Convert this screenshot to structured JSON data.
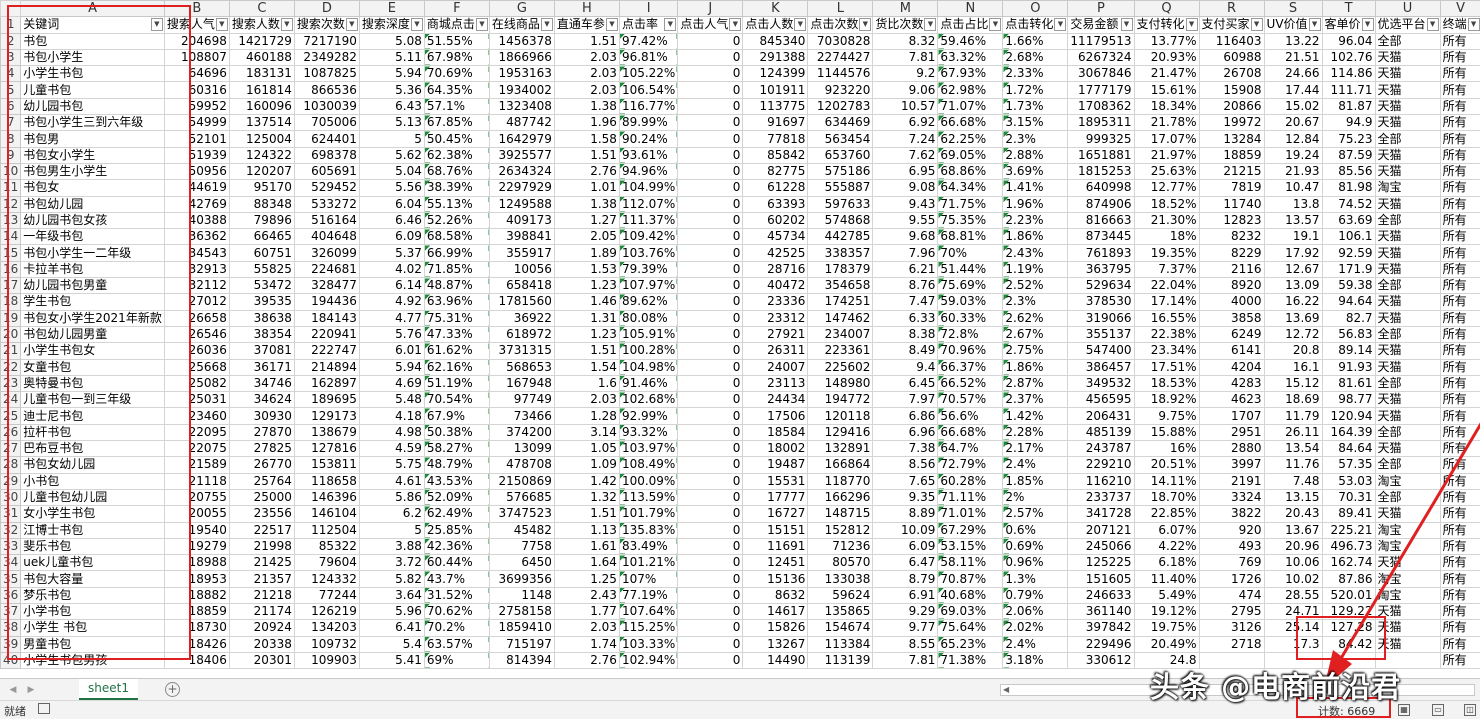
{
  "columns": [
    "A",
    "B",
    "C",
    "D",
    "E",
    "F",
    "G",
    "H",
    "I",
    "J",
    "K",
    "L",
    "M",
    "N",
    "O",
    "P",
    "Q",
    "R",
    "S",
    "T",
    "U",
    "V"
  ],
  "headers": [
    "关键词",
    "搜索人气",
    "搜索人数",
    "搜索次数",
    "搜索深度",
    "商城点击",
    "在线商品",
    "直通车参",
    "点击率",
    "点击人气",
    "点击人数",
    "点击次数",
    "货比次数",
    "点击占比",
    "点击转化",
    "交易金额",
    "支付转化",
    "支付买家",
    "UV价值",
    "客单价",
    "优选平台",
    "终端"
  ],
  "rows": [
    [
      "书包",
      "204698",
      "1421729",
      "7217190",
      "5.08",
      "51.55%",
      "1456378",
      "1.51",
      "97.42%",
      "0",
      "845340",
      "7030828",
      "8.32",
      "59.46%",
      "1.66%",
      "11179513",
      "13.77%",
      "116403",
      "13.22",
      "96.04",
      "全部",
      "所有"
    ],
    [
      "书包小学生",
      "108807",
      "460188",
      "2349282",
      "5.11",
      "67.98%",
      "1866966",
      "2.03",
      "96.81%",
      "0",
      "291388",
      "2274427",
      "7.81",
      "63.32%",
      "2.68%",
      "6267324",
      "20.93%",
      "60988",
      "21.51",
      "102.76",
      "天猫",
      "所有"
    ],
    [
      "小学生书包",
      "64696",
      "183131",
      "1087825",
      "5.94",
      "70.69%",
      "1953163",
      "2.03",
      "105.22%",
      "0",
      "124399",
      "1144576",
      "9.2",
      "67.93%",
      "2.33%",
      "3067846",
      "21.47%",
      "26708",
      "24.66",
      "114.86",
      "天猫",
      "所有"
    ],
    [
      "儿童书包",
      "60316",
      "161814",
      "866536",
      "5.36",
      "64.35%",
      "1934002",
      "2.03",
      "106.54%",
      "0",
      "101911",
      "923220",
      "9.06",
      "62.98%",
      "1.72%",
      "1777179",
      "15.61%",
      "15908",
      "17.44",
      "111.71",
      "天猫",
      "所有"
    ],
    [
      "幼儿园书包",
      "59952",
      "160096",
      "1030039",
      "6.43",
      "57.1%",
      "1323408",
      "1.38",
      "116.77%",
      "0",
      "113775",
      "1202783",
      "10.57",
      "71.07%",
      "1.73%",
      "1708362",
      "18.34%",
      "20866",
      "15.02",
      "81.87",
      "天猫",
      "所有"
    ],
    [
      "书包小学生三到六年级",
      "54999",
      "137514",
      "705006",
      "5.13",
      "67.85%",
      "487742",
      "1.96",
      "89.99%",
      "0",
      "91697",
      "634469",
      "6.92",
      "66.68%",
      "3.15%",
      "1895311",
      "21.78%",
      "19972",
      "20.67",
      "94.9",
      "天猫",
      "所有"
    ],
    [
      "书包男",
      "52101",
      "125004",
      "624401",
      "5",
      "50.45%",
      "1642979",
      "1.58",
      "90.24%",
      "0",
      "77818",
      "563454",
      "7.24",
      "62.25%",
      "2.3%",
      "999325",
      "17.07%",
      "13284",
      "12.84",
      "75.23",
      "全部",
      "所有"
    ],
    [
      "书包女小学生",
      "51939",
      "124322",
      "698378",
      "5.62",
      "62.38%",
      "3925577",
      "1.51",
      "93.61%",
      "0",
      "85842",
      "653760",
      "7.62",
      "69.05%",
      "2.88%",
      "1651881",
      "21.97%",
      "18859",
      "19.24",
      "87.59",
      "天猫",
      "所有"
    ],
    [
      "书包男生小学生",
      "50956",
      "120207",
      "605691",
      "5.04",
      "68.76%",
      "2634324",
      "2.76",
      "94.96%",
      "0",
      "82775",
      "575186",
      "6.95",
      "68.86%",
      "3.69%",
      "1815253",
      "25.63%",
      "21215",
      "21.93",
      "85.56",
      "天猫",
      "所有"
    ],
    [
      "书包女",
      "44619",
      "95170",
      "529452",
      "5.56",
      "38.39%",
      "2297929",
      "1.01",
      "104.99%",
      "0",
      "61228",
      "555887",
      "9.08",
      "64.34%",
      "1.41%",
      "640998",
      "12.77%",
      "7819",
      "10.47",
      "81.98",
      "淘宝",
      "所有"
    ],
    [
      "书包幼儿园",
      "42769",
      "88348",
      "533272",
      "6.04",
      "55.13%",
      "1249588",
      "1.38",
      "112.07%",
      "0",
      "63393",
      "597633",
      "9.43",
      "71.75%",
      "1.96%",
      "874906",
      "18.52%",
      "11740",
      "13.8",
      "74.52",
      "天猫",
      "所有"
    ],
    [
      "幼儿园书包女孩",
      "40388",
      "79896",
      "516164",
      "6.46",
      "52.26%",
      "409173",
      "1.27",
      "111.37%",
      "0",
      "60202",
      "574868",
      "9.55",
      "75.35%",
      "2.23%",
      "816663",
      "21.30%",
      "12823",
      "13.57",
      "63.69",
      "全部",
      "所有"
    ],
    [
      "一年级书包",
      "36362",
      "66465",
      "404648",
      "6.09",
      "68.58%",
      "398841",
      "2.05",
      "109.42%",
      "0",
      "45734",
      "442785",
      "9.68",
      "68.81%",
      "1.86%",
      "873445",
      "18%",
      "8232",
      "19.1",
      "106.1",
      "天猫",
      "所有"
    ],
    [
      "书包小学生一二年级",
      "34543",
      "60751",
      "326099",
      "5.37",
      "66.99%",
      "355917",
      "1.89",
      "103.76%",
      "0",
      "42525",
      "338357",
      "7.96",
      "70%",
      "2.43%",
      "761893",
      "19.35%",
      "8229",
      "17.92",
      "92.59",
      "天猫",
      "所有"
    ],
    [
      "卡拉羊书包",
      "32913",
      "55825",
      "224681",
      "4.02",
      "71.85%",
      "10056",
      "1.53",
      "79.39%",
      "0",
      "28716",
      "178379",
      "6.21",
      "51.44%",
      "1.19%",
      "363795",
      "7.37%",
      "2116",
      "12.67",
      "171.9",
      "天猫",
      "所有"
    ],
    [
      "幼儿园书包男童",
      "32112",
      "53472",
      "328477",
      "6.14",
      "48.87%",
      "658418",
      "1.23",
      "107.97%",
      "0",
      "40472",
      "354658",
      "8.76",
      "75.69%",
      "2.52%",
      "529634",
      "22.04%",
      "8920",
      "13.09",
      "59.38",
      "全部",
      "所有"
    ],
    [
      "学生书包",
      "27012",
      "39535",
      "194436",
      "4.92",
      "63.96%",
      "1781560",
      "1.46",
      "89.62%",
      "0",
      "23336",
      "174251",
      "7.47",
      "59.03%",
      "2.3%",
      "378530",
      "17.14%",
      "4000",
      "16.22",
      "94.64",
      "天猫",
      "所有"
    ],
    [
      "书包女小学生2021年新款",
      "26658",
      "38638",
      "184143",
      "4.77",
      "75.31%",
      "36922",
      "1.31",
      "80.08%",
      "0",
      "23312",
      "147462",
      "6.33",
      "60.33%",
      "2.62%",
      "319066",
      "16.55%",
      "3858",
      "13.69",
      "82.7",
      "天猫",
      "所有"
    ],
    [
      "书包幼儿园男童",
      "26546",
      "38354",
      "220941",
      "5.76",
      "47.33%",
      "618972",
      "1.23",
      "105.91%",
      "0",
      "27921",
      "234007",
      "8.38",
      "72.8%",
      "2.67%",
      "355137",
      "22.38%",
      "6249",
      "12.72",
      "56.83",
      "全部",
      "所有"
    ],
    [
      "小学生书包女",
      "26036",
      "37081",
      "222747",
      "6.01",
      "61.62%",
      "3731315",
      "1.51",
      "100.28%",
      "0",
      "26311",
      "223361",
      "8.49",
      "70.96%",
      "2.75%",
      "547400",
      "23.34%",
      "6141",
      "20.8",
      "89.14",
      "天猫",
      "所有"
    ],
    [
      "女童书包",
      "25668",
      "36171",
      "214894",
      "5.94",
      "62.16%",
      "568653",
      "1.54",
      "104.98%",
      "0",
      "24007",
      "225602",
      "9.4",
      "66.37%",
      "1.86%",
      "386457",
      "17.51%",
      "4204",
      "16.1",
      "91.93",
      "天猫",
      "所有"
    ],
    [
      "奥特曼书包",
      "25082",
      "34746",
      "162897",
      "4.69",
      "51.19%",
      "167948",
      "1.6",
      "91.46%",
      "0",
      "23113",
      "148980",
      "6.45",
      "66.52%",
      "2.87%",
      "349532",
      "18.53%",
      "4283",
      "15.12",
      "81.61",
      "全部",
      "所有"
    ],
    [
      "儿童书包一到三年级",
      "25031",
      "34624",
      "189695",
      "5.48",
      "70.54%",
      "97749",
      "2.03",
      "102.68%",
      "0",
      "24434",
      "194772",
      "7.97",
      "70.57%",
      "2.37%",
      "456595",
      "18.92%",
      "4623",
      "18.69",
      "98.77",
      "天猫",
      "所有"
    ],
    [
      "迪士尼书包",
      "23460",
      "30930",
      "129173",
      "4.18",
      "67.9%",
      "73466",
      "1.28",
      "92.99%",
      "0",
      "17506",
      "120118",
      "6.86",
      "56.6%",
      "1.42%",
      "206431",
      "9.75%",
      "1707",
      "11.79",
      "120.94",
      "天猫",
      "所有"
    ],
    [
      "拉杆书包",
      "22095",
      "27870",
      "138679",
      "4.98",
      "50.38%",
      "374200",
      "3.14",
      "93.32%",
      "0",
      "18584",
      "129416",
      "6.96",
      "66.68%",
      "2.28%",
      "485139",
      "15.88%",
      "2951",
      "26.11",
      "164.39",
      "全部",
      "所有"
    ],
    [
      "巴布豆书包",
      "22075",
      "27825",
      "127816",
      "4.59",
      "58.27%",
      "13099",
      "1.05",
      "103.97%",
      "0",
      "18002",
      "132891",
      "7.38",
      "64.7%",
      "2.17%",
      "243787",
      "16%",
      "2880",
      "13.54",
      "84.64",
      "天猫",
      "所有"
    ],
    [
      "书包女幼儿园",
      "21589",
      "26770",
      "153811",
      "5.75",
      "48.79%",
      "478708",
      "1.09",
      "108.49%",
      "0",
      "19487",
      "166864",
      "8.56",
      "72.79%",
      "2.4%",
      "229210",
      "20.51%",
      "3997",
      "11.76",
      "57.35",
      "全部",
      "所有"
    ],
    [
      "小书包",
      "21118",
      "25764",
      "118658",
      "4.61",
      "43.53%",
      "2150869",
      "1.42",
      "100.09%",
      "0",
      "15531",
      "118770",
      "7.65",
      "60.28%",
      "1.85%",
      "116210",
      "14.11%",
      "2191",
      "7.48",
      "53.03",
      "淘宝",
      "所有"
    ],
    [
      "儿童书包幼儿园",
      "20755",
      "25000",
      "146396",
      "5.86",
      "52.09%",
      "576685",
      "1.32",
      "113.59%",
      "0",
      "17777",
      "166296",
      "9.35",
      "71.11%",
      "2%",
      "233737",
      "18.70%",
      "3324",
      "13.15",
      "70.31",
      "全部",
      "所有"
    ],
    [
      "女小学生书包",
      "20055",
      "23556",
      "146104",
      "6.2",
      "62.49%",
      "3747523",
      "1.51",
      "101.79%",
      "0",
      "16727",
      "148715",
      "8.89",
      "71.01%",
      "2.57%",
      "341728",
      "22.85%",
      "3822",
      "20.43",
      "89.41",
      "天猫",
      "所有"
    ],
    [
      "江博士书包",
      "19540",
      "22517",
      "112504",
      "5",
      "25.85%",
      "45482",
      "1.13",
      "135.83%",
      "0",
      "15151",
      "152812",
      "10.09",
      "67.29%",
      "0.6%",
      "207121",
      "6.07%",
      "920",
      "13.67",
      "225.21",
      "淘宝",
      "所有"
    ],
    [
      "斐乐书包",
      "19279",
      "21998",
      "85322",
      "3.88",
      "42.36%",
      "7758",
      "1.61",
      "83.49%",
      "0",
      "11691",
      "71236",
      "6.09",
      "53.15%",
      "0.69%",
      "245066",
      "4.22%",
      "493",
      "20.96",
      "496.73",
      "淘宝",
      "所有"
    ],
    [
      "uek儿童书包",
      "18988",
      "21425",
      "79604",
      "3.72",
      "60.44%",
      "6450",
      "1.64",
      "101.21%",
      "0",
      "12451",
      "80570",
      "6.47",
      "58.11%",
      "0.96%",
      "125225",
      "6.18%",
      "769",
      "10.06",
      "162.74",
      "天猫",
      "所有"
    ],
    [
      "书包大容量",
      "18953",
      "21357",
      "124332",
      "5.82",
      "43.7%",
      "3699356",
      "1.25",
      "107%",
      "0",
      "15136",
      "133038",
      "8.79",
      "70.87%",
      "1.3%",
      "151605",
      "11.40%",
      "1726",
      "10.02",
      "87.86",
      "淘宝",
      "所有"
    ],
    [
      "梦乐书包",
      "18882",
      "21218",
      "77244",
      "3.64",
      "31.52%",
      "1148",
      "2.43",
      "77.19%",
      "0",
      "8632",
      "59624",
      "6.91",
      "40.68%",
      "0.79%",
      "246633",
      "5.49%",
      "474",
      "28.55",
      "520.01",
      "淘宝",
      "所有"
    ],
    [
      "小学书包",
      "18859",
      "21174",
      "126219",
      "5.96",
      "70.62%",
      "2758158",
      "1.77",
      "107.64%",
      "0",
      "14617",
      "135865",
      "9.29",
      "69.03%",
      "2.06%",
      "361140",
      "19.12%",
      "2795",
      "24.71",
      "129.22",
      "天猫",
      "所有"
    ],
    [
      "小学生 书包",
      "18730",
      "20924",
      "134203",
      "6.41",
      "70.2%",
      "1859410",
      "2.03",
      "115.25%",
      "0",
      "15826",
      "154674",
      "9.77",
      "75.64%",
      "2.02%",
      "397842",
      "19.75%",
      "3126",
      "25.14",
      "127.28",
      "天猫",
      "所有"
    ],
    [
      "男童书包",
      "18426",
      "20338",
      "109732",
      "5.4",
      "63.57%",
      "715197",
      "1.74",
      "103.33%",
      "0",
      "13267",
      "113384",
      "8.55",
      "65.23%",
      "2.4%",
      "229496",
      "20.49%",
      "2718",
      "17.3",
      "84.42",
      "天猫",
      "所有"
    ],
    [
      "小学生书包男孩",
      "18406",
      "20301",
      "109903",
      "5.41",
      "69%",
      "814394",
      "2.76",
      "102.94%",
      "0",
      "14490",
      "113139",
      "7.81",
      "71.38%",
      "3.18%",
      "330612",
      "24.8",
      "",
      "",
      "",
      "",
      "所有"
    ]
  ],
  "sheet_tab": "sheet1",
  "status": {
    "ready": "就绪",
    "count": "计数: 6669"
  },
  "watermark": "头条 @电商前沿君"
}
